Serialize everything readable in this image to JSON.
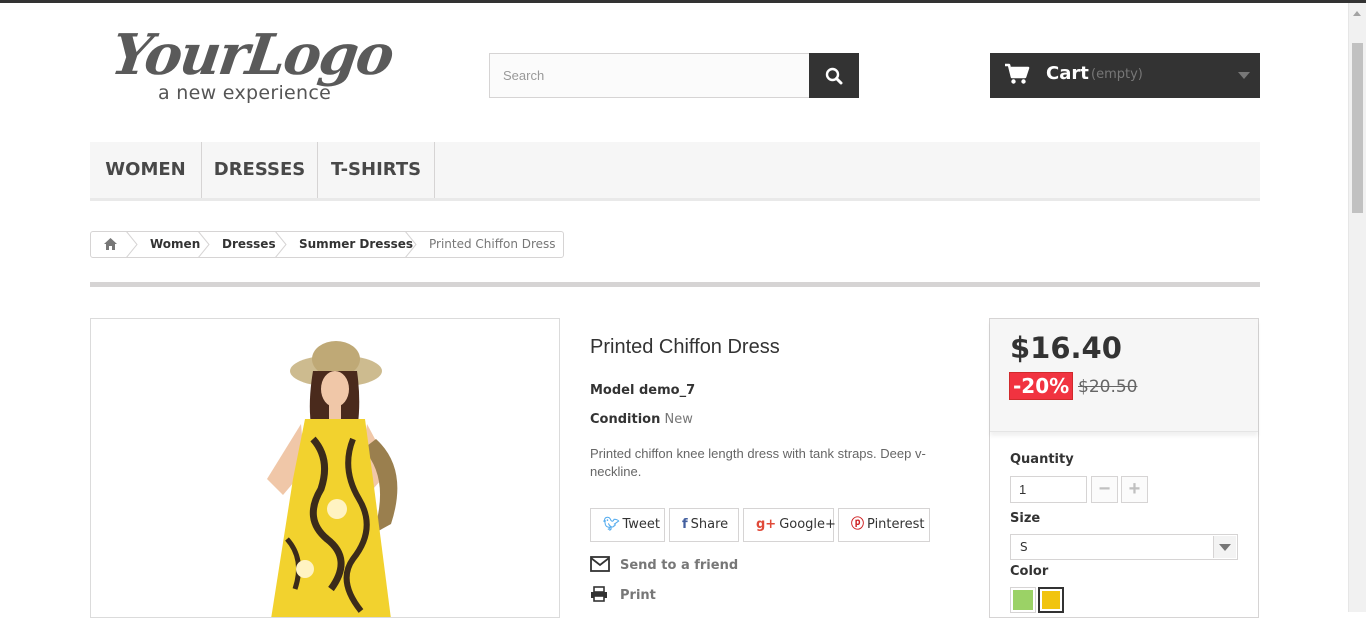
{
  "header": {
    "logo_text": "YourLogo",
    "logo_tagline": "a new experience",
    "search_placeholder": "Search",
    "cart_label": "Cart",
    "cart_status": "(empty)"
  },
  "menu": {
    "items": [
      {
        "label": "Women"
      },
      {
        "label": "Dresses"
      },
      {
        "label": "T-shirts"
      }
    ]
  },
  "breadcrumb": {
    "items": [
      "Women",
      "Dresses",
      "Summer Dresses",
      "Printed Chiffon Dress"
    ]
  },
  "product": {
    "name": "Printed Chiffon Dress",
    "model_label": "Model demo_7",
    "condition_label": "Condition",
    "condition_value": "New",
    "description": "Printed chiffon knee length dress with tank straps. Deep v-neckline.",
    "share": {
      "tweet": "Tweet",
      "share": "Share",
      "google": "Google+",
      "pinterest": "Pinterest"
    },
    "send_to_friend": "Send to a friend",
    "print": "Print"
  },
  "buy_box": {
    "price": "$16.40",
    "reduction": "-20%",
    "old_price": "$20.50",
    "quantity_label": "Quantity",
    "quantity_value": "1",
    "size_label": "Size",
    "size_value": "S",
    "color_label": "Color",
    "colors": [
      "#9bd266",
      "#f1c40f"
    ],
    "selected_color_index": 1
  },
  "colors": {
    "dark": "#333333",
    "menu_bg": "#f6f6f6",
    "reduction_red": "#f13340",
    "twitter": "#55acee",
    "facebook": "#435f9f",
    "google": "#e04a39",
    "pinterest": "#ce1f21"
  }
}
